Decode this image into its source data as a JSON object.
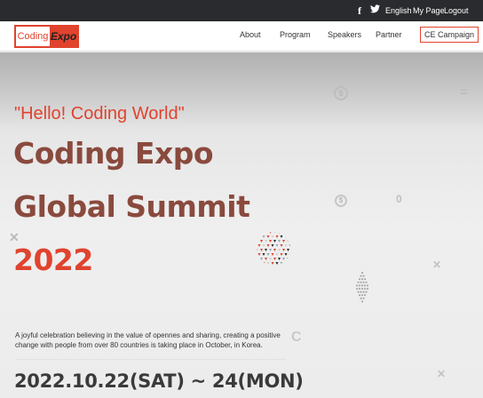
{
  "topbar": {
    "facebook_icon": "f",
    "twitter_icon": "🐦",
    "language": "English",
    "mypage": "My Page",
    "logout": "Logout"
  },
  "logo": {
    "part1": "Coding",
    "part2": "Expo"
  },
  "nav": {
    "items": [
      "About",
      "Program",
      "Speakers",
      "Partner"
    ],
    "campaign": "CE Campaign"
  },
  "hero": {
    "greeting": "\"Hello! Coding World\"",
    "title_line1": "Coding Expo",
    "title_line2": "Global Summit",
    "year": "2022",
    "description": "A joyful celebration believing in the value of opennes and sharing, creating a positive change with people from over 80 countries is taking place in October, in Korea.",
    "dates": "2022.10.22(SAT) ~ 24(MON)"
  },
  "colors": {
    "accent": "#e0432e",
    "title_brown": "#8a4a3e",
    "topbar": "#2a2b2e"
  }
}
